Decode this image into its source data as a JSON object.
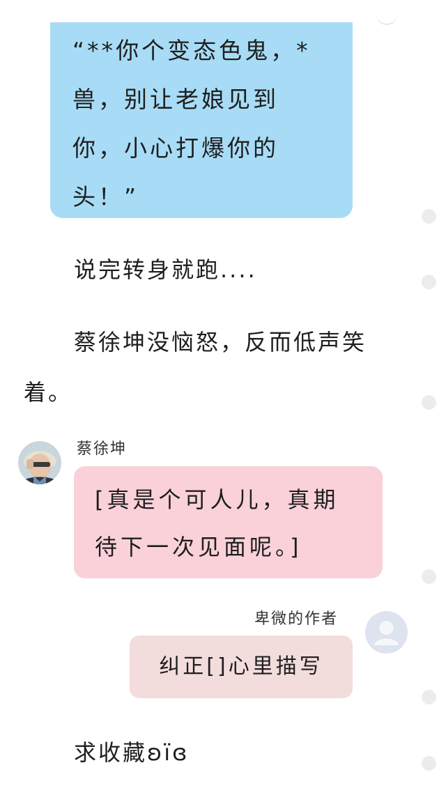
{
  "blue_bubble": {
    "lines": [
      "“**你个变态色鬼，*",
      "兽，别让老娘见到",
      "你，小心打爆你的",
      "头！”"
    ]
  },
  "narration": {
    "line1": "说完转身就跑....",
    "line2a": "蔡徐坤没恼怒，反而低声笑",
    "line2b": "着。"
  },
  "message_cai": {
    "sender": "蔡徐坤",
    "lines": [
      "[真是个可人儿，真期",
      "待下一次见面呢。]"
    ]
  },
  "message_author": {
    "sender": "卑微的作者",
    "text": "纠正[]心里描写"
  },
  "closing": {
    "text": "求收藏ʚïɞ"
  },
  "colors": {
    "blue_bubble": "#a8dcf6",
    "pink_bubble": "#fad1d9",
    "rose_bubble": "#f3dcdc"
  },
  "icons": [
    "default-avatar-icon",
    "cai-xukun-avatar"
  ]
}
